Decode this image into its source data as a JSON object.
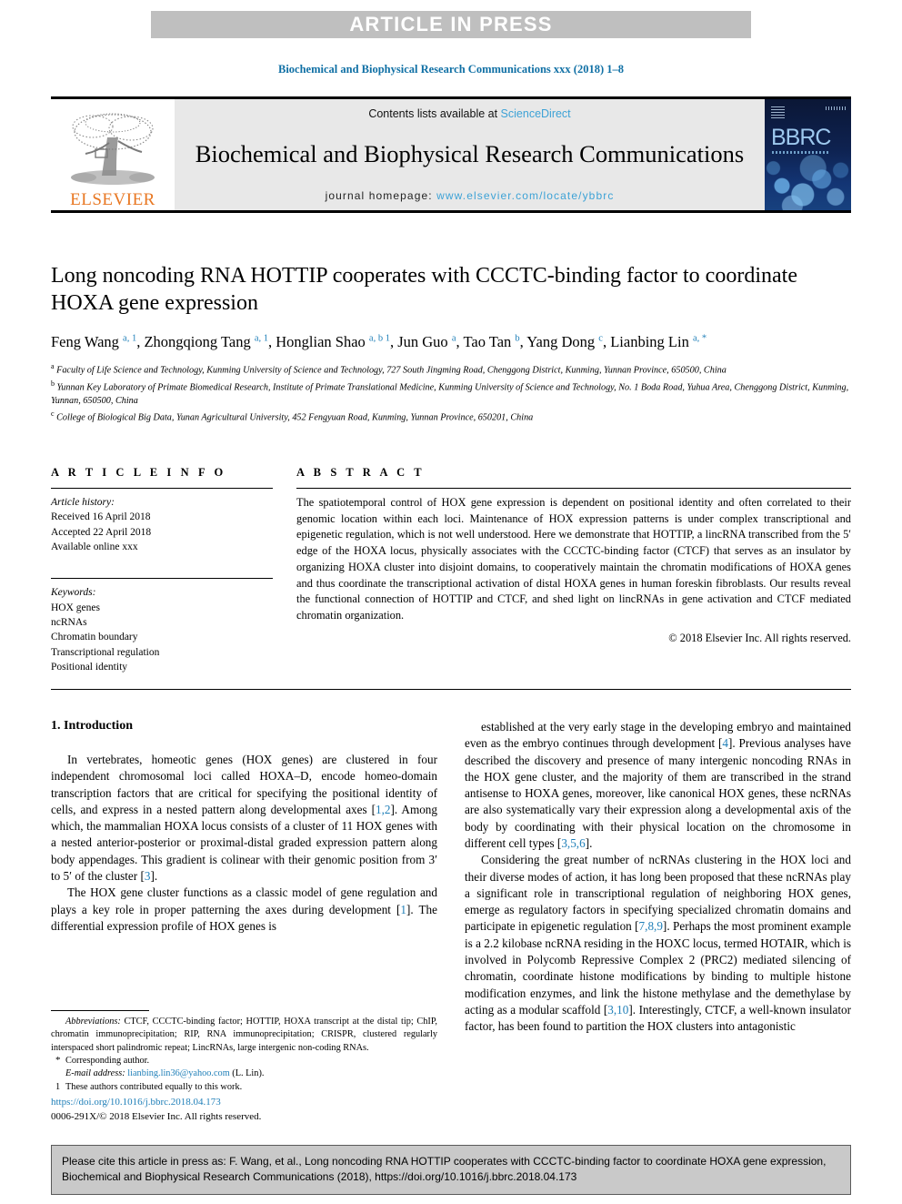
{
  "banner": {
    "text": "ARTICLE IN PRESS"
  },
  "journal_ref": "Biochemical and Biophysical Research Communications xxx (2018) 1–8",
  "masthead": {
    "publisher_name": "ELSEVIER",
    "contents_prefix": "Contents lists available at ",
    "contents_link": "ScienceDirect",
    "journal_title": "Biochemical and Biophysical Research Communications",
    "homepage_label": "journal homepage: ",
    "homepage_url": "www.elsevier.com/locate/ybbrc",
    "cover_mark": "BBRC"
  },
  "article": {
    "title": "Long noncoding RNA HOTTIP cooperates with CCCTC-binding factor to coordinate HOXA gene expression",
    "authors": [
      {
        "name": "Feng Wang",
        "marks": "a, 1",
        "sep": ", "
      },
      {
        "name": "Zhongqiong Tang",
        "marks": "a, 1",
        "sep": ", "
      },
      {
        "name": "Honglian Shao",
        "marks": "a, b 1",
        "sep": ", "
      },
      {
        "name": "Jun Guo",
        "marks": "a",
        "sep": ", "
      },
      {
        "name": "Tao Tan",
        "marks": "b",
        "sep": ", "
      },
      {
        "name": "Yang Dong",
        "marks": "c",
        "sep": ", "
      },
      {
        "name": "Lianbing Lin",
        "marks": "a, *",
        "sep": ""
      }
    ],
    "affiliations": [
      {
        "mark": "a",
        "text": "Faculty of Life Science and Technology, Kunming University of Science and Technology, 727 South Jingming Road, Chenggong District, Kunming, Yunnan Province, 650500, China"
      },
      {
        "mark": "b",
        "text": "Yunnan Key Laboratory of Primate Biomedical Research, Institute of Primate Translational Medicine, Kunming University of Science and Technology, No. 1 Boda Road, Yuhua Area, Chenggong District, Kunming, Yunnan, 650500, China"
      },
      {
        "mark": "c",
        "text": "College of Biological Big Data, Yunan Agricultural University, 452 Fengyuan Road, Kunming, Yunnan Province, 650201, China"
      }
    ]
  },
  "article_info": {
    "heading": "A R T I C L E   I N F O",
    "history_label": "Article history:",
    "history": [
      "Received 16 April 2018",
      "Accepted 22 April 2018",
      "Available online xxx"
    ],
    "keywords_label": "Keywords:",
    "keywords": [
      "HOX genes",
      "ncRNAs",
      "Chromatin boundary",
      "Transcriptional regulation",
      "Positional identity"
    ]
  },
  "abstract": {
    "heading": "A B S T R A C T",
    "body": "The spatiotemporal control of HOX gene expression is dependent on positional identity and often correlated to their genomic location within each loci. Maintenance of HOX expression patterns is under complex transcriptional and epigenetic regulation, which is not well understood. Here we demonstrate that HOTTIP, a lincRNA transcribed from the 5′ edge of the HOXA locus, physically associates with the CCCTC-binding factor (CTCF) that serves as an insulator by organizing HOXA cluster into disjoint domains, to cooperatively maintain the chromatin modifications of HOXA genes and thus coordinate the transcriptional activation of distal HOXA genes in human foreskin fibroblasts. Our results reveal the functional connection of HOTTIP and CTCF, and shed light on lincRNAs in gene activation and CTCF mediated chromatin organization.",
    "copyright": "© 2018 Elsevier Inc. All rights reserved."
  },
  "body": {
    "section_heading": "1. Introduction",
    "left_paragraphs": [
      {
        "parts": [
          {
            "t": "In vertebrates, homeotic genes (HOX genes) are clustered in four independent chromosomal loci called HOXA–D, encode homeo-domain transcription factors that are critical for specifying the positional identity of cells, and express in a nested pattern along developmental axes ["
          },
          {
            "t": "1,2",
            "cite": true
          },
          {
            "t": "]. Among which, the mammalian HOXA locus consists of a cluster of 11 HOX genes with a nested anterior-posterior or proximal-distal graded expression pattern along body appendages. This gradient is colinear with their genomic position from 3′ to 5′ of the cluster ["
          },
          {
            "t": "3",
            "cite": true
          },
          {
            "t": "]."
          }
        ]
      },
      {
        "parts": [
          {
            "t": "The HOX gene cluster functions as a classic model of gene regulation and plays a key role in proper patterning the axes during development ["
          },
          {
            "t": "1",
            "cite": true
          },
          {
            "t": "]. The differential expression profile of HOX genes is"
          }
        ]
      }
    ],
    "right_paragraphs": [
      {
        "parts": [
          {
            "t": "established at the very early stage in the developing embryo and maintained even as the embryo continues through development ["
          },
          {
            "t": "4",
            "cite": true
          },
          {
            "t": "]. Previous analyses have described the discovery and presence of many intergenic noncoding RNAs in the HOX gene cluster, and the majority of them are transcribed in the strand antisense to HOXA genes, moreover, like canonical HOX genes, these ncRNAs are also systematically vary their expression along a developmental axis of the body by coordinating with their physical location on the chromosome in different cell types ["
          },
          {
            "t": "3,5,6",
            "cite": true
          },
          {
            "t": "]."
          }
        ]
      },
      {
        "parts": [
          {
            "t": "Considering the great number of ncRNAs clustering in the HOX loci and their diverse modes of action, it has long been proposed that these ncRNAs play a significant role in transcriptional regulation of neighboring HOX genes, emerge as regulatory factors in specifying specialized chromatin domains and participate in epigenetic regulation ["
          },
          {
            "t": "7,8,9",
            "cite": true
          },
          {
            "t": "]. Perhaps the most prominent example is a 2.2 kilobase ncRNA residing in the HOXC locus, termed HOTAIR, which is involved in Polycomb Repressive Complex 2 (PRC2) mediated silencing of chromatin, coordinate histone modifications by binding to multiple histone modification enzymes, and link the histone methylase and the demethylase by acting as a modular scaffold ["
          },
          {
            "t": "3,10",
            "cite": true
          },
          {
            "t": "]. Interestingly, CTCF, a well-known insulator factor, has been found to partition the HOX clusters into antagonistic"
          }
        ]
      }
    ]
  },
  "footnotes": {
    "abbrev_label": "Abbreviations:",
    "abbrev_text": " CTCF, CCCTC-binding factor; HOTTIP, HOXA transcript at the distal tip; ChIP, chromatin immunoprecipitation; RIP, RNA immunoprecipitation; CRISPR, clustered regularly interspaced short palindromic repeat; LincRNAs, large intergenic non-coding RNAs.",
    "corresponding": "Corresponding author.",
    "corresponding_mark": "*",
    "email_label": "E-mail address:",
    "email": "lianbing.lin36@yahoo.com",
    "email_suffix": " (L. Lin).",
    "equal_mark": "1",
    "equal_text": "These authors contributed equally to this work."
  },
  "doi_footer": {
    "doi": "https://doi.org/10.1016/j.bbrc.2018.04.173",
    "issn_line": "0006-291X/© 2018 Elsevier Inc. All rights reserved."
  },
  "cite_box": {
    "text": "Please cite this article in press as: F. Wang, et al., Long noncoding RNA HOTTIP cooperates with CCCTC-binding factor to coordinate HOXA gene expression, Biochemical and Biophysical Research Communications (2018), https://doi.org/10.1016/j.bbrc.2018.04.173"
  },
  "colors": {
    "link_blue": "#1f7fb8",
    "light_blue": "#3da2d6",
    "elsevier_orange": "#e87722",
    "banner_gray": "#bfbfbf",
    "cite_box_gray": "#c9c9c9"
  }
}
